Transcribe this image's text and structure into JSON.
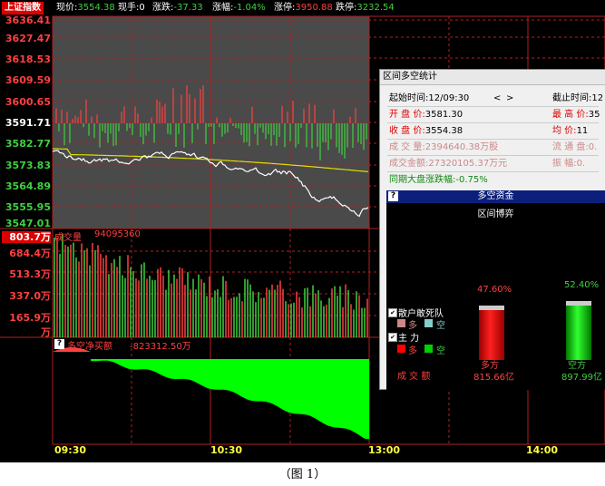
{
  "header": {
    "title": "上证指数",
    "current_label": "现价:",
    "current_value": "3554.38",
    "volume_label": "现手:",
    "volume_value": "0",
    "change_label": "涨跌:",
    "change_value": "-37.33",
    "pct_label": "涨幅:",
    "pct_value": "-1.04%",
    "limit_up_label": "涨停:",
    "limit_up_value": "3950.88",
    "limit_down_label": "跌停:",
    "limit_down_value": "3232.54"
  },
  "price_axis": {
    "labels_red": [
      "3636.41",
      "3627.47",
      "3618.53",
      "3609.59",
      "3600.65"
    ],
    "label_mid": "3591.71",
    "labels_green": [
      "3582.77",
      "3573.83",
      "3564.89",
      "3555.95",
      "3547.01"
    ]
  },
  "volume_panel": {
    "title": "成交量",
    "total": "94095360",
    "axis_top": "803.7万",
    "axis_labels": [
      "684.4万",
      "513.3万",
      "337.0万",
      "165.9万",
      "万"
    ]
  },
  "net_panel": {
    "icon": "?",
    "title": "多空净买额",
    "value": "-823312.50万"
  },
  "time_axis": [
    "09:30",
    "10:30",
    "13:00",
    "14:00"
  ],
  "popup": {
    "title": "区间多空统计",
    "start_label": "起始时间:",
    "start_value": "12/09:30",
    "nav_prev": "<",
    "nav_next": ">",
    "end_label": "截止时间:",
    "end_value": "12",
    "open_label": "开 盘 价:",
    "open_value": "3581.30",
    "high_label": "最 高 价:",
    "high_value": "35",
    "close_label": "收 盘 价:",
    "close_value": "3554.38",
    "avg_label": "均    价:",
    "avg_value": "11",
    "vol_label": "成 交 量:",
    "vol_value": "2394640.38万股",
    "float_label": "流 通 盘:",
    "float_value": "0.",
    "amount_label": "成交金额:",
    "amount_value": "27320105.37万元",
    "amp_label": "振    幅:",
    "amp_value": "0.",
    "big_label": "同期大盘涨跌幅:",
    "big_value": "-0.75%"
  },
  "capital": {
    "header_icon": "?",
    "header": "多空资金",
    "subtitle": "区间博弈",
    "retail_label": "散户敢死队",
    "retail_long": "多",
    "retail_short": "空",
    "main_label": "主      力",
    "main_long": "多",
    "main_short": "空",
    "amount_label": "成  交  额",
    "long_pct": "47.60%",
    "short_pct": "52.40%",
    "long_name": "多方",
    "short_name": "空方",
    "long_amount": "815.66亿",
    "short_amount": "897.99亿",
    "long_share": 0.476,
    "short_share": 0.524
  },
  "caption": "（图 1）",
  "colors": {
    "up": "#ff4040",
    "down": "#3fd13f",
    "avg_line": "#e0e000",
    "price_line": "#ffffff",
    "grid": "#b02020"
  }
}
